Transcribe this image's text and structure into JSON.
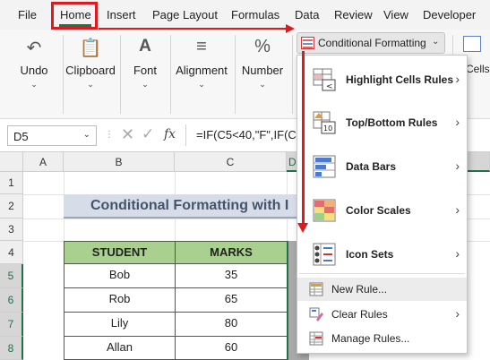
{
  "menu": {
    "file": "File",
    "home": "Home",
    "insert": "Insert",
    "page_layout": "Page Layout",
    "formulas": "Formulas",
    "data": "Data",
    "review": "Review",
    "view": "View",
    "developer": "Developer"
  },
  "ribbon": {
    "undo": "Undo",
    "clipboard": "Clipboard",
    "font": "Font",
    "alignment": "Alignment",
    "number": "Number",
    "number_icon": "%",
    "conditional_formatting": "Conditional Formatting",
    "cells_partial": "Cells"
  },
  "formula_bar": {
    "name_box": "D5",
    "formula": "=IF(C5<40,\"F\",IF(C("
  },
  "sheet": {
    "columns": [
      "A",
      "B",
      "C",
      "D"
    ],
    "rows": [
      "1",
      "2",
      "3",
      "4",
      "5",
      "6",
      "7",
      "8"
    ],
    "title": "Conditional Formatting with I",
    "headers": [
      "STUDENT",
      "MARKS"
    ],
    "records": [
      {
        "student": "Bob",
        "marks": "35"
      },
      {
        "student": "Rob",
        "marks": "65"
      },
      {
        "student": "Lily",
        "marks": "80"
      },
      {
        "student": "Allan",
        "marks": "60"
      }
    ]
  },
  "dropdown": {
    "items": [
      {
        "label": "Highlight Cells Rules",
        "icon": "highlight-cells-icon"
      },
      {
        "label": "Top/Bottom Rules",
        "icon": "top-bottom-icon"
      },
      {
        "label": "Data Bars",
        "icon": "data-bars-icon"
      },
      {
        "label": "Color Scales",
        "icon": "color-scales-icon"
      },
      {
        "label": "Icon Sets",
        "icon": "icon-sets-icon"
      }
    ],
    "top_bottom_icon_text": "10",
    "new_rule": "New Rule...",
    "clear_rules": "Clear Rules",
    "manage_rules": "Manage Rules..."
  },
  "colors": {
    "excel_green": "#217346",
    "highlight_red": "#e0191e",
    "table_header": "#a9d08e",
    "title_fill": "#d7dde8"
  }
}
